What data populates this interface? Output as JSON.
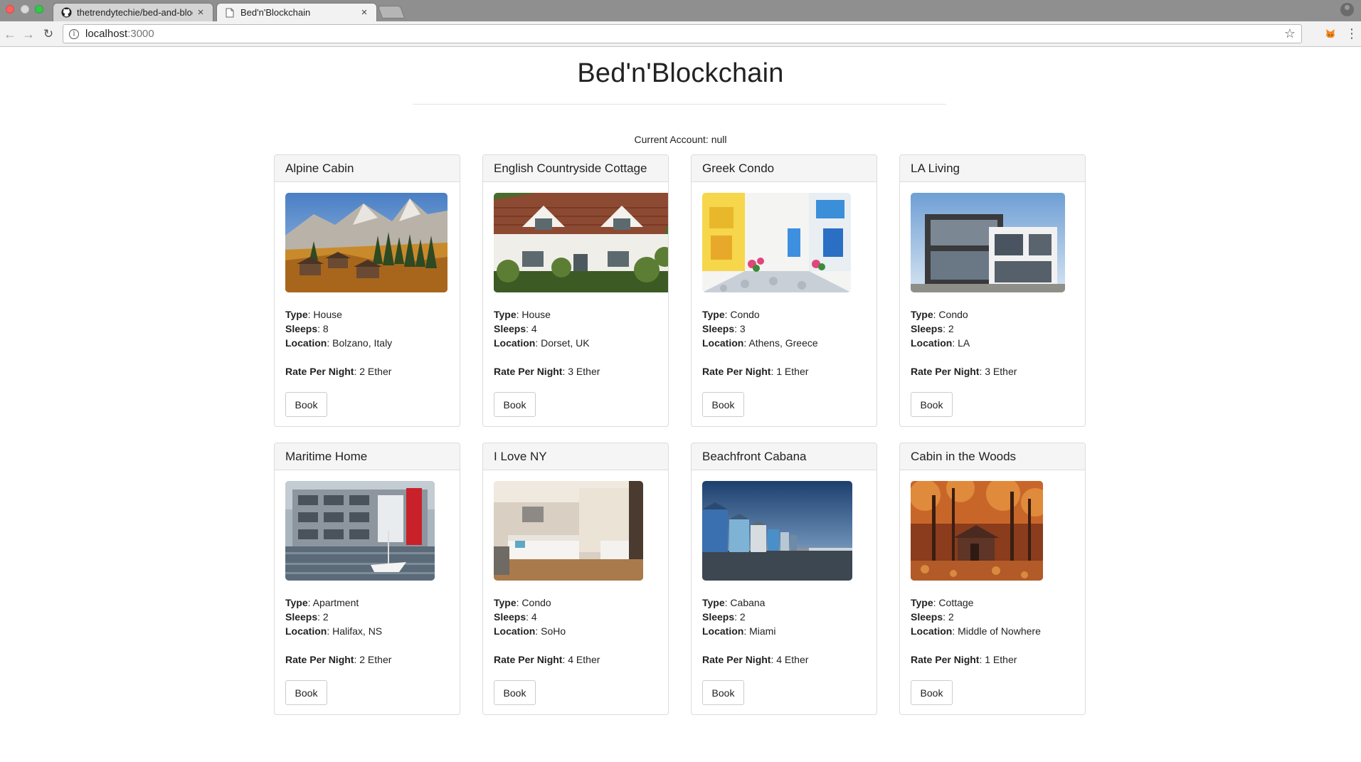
{
  "browser": {
    "tabs": [
      {
        "title": "thetrendytechie/bed-and-bloc",
        "icon": "github-icon",
        "active": false
      },
      {
        "title": "Bed'n'Blockchain",
        "icon": "page-icon",
        "active": true
      }
    ],
    "url_host": "localhost",
    "url_port": ":3000"
  },
  "page": {
    "title": "Bed'n'Blockchain",
    "account_label": "Current Account:",
    "account_value": "null"
  },
  "labels": {
    "type": "Type",
    "sleeps": "Sleeps",
    "location": "Location",
    "rate": "Rate Per Night",
    "book": "Book"
  },
  "listings": [
    {
      "name": "Alpine Cabin",
      "type": "House",
      "sleeps": "8",
      "location": "Bolzano, Italy",
      "rate": "2 Ether",
      "photo": "alpine-cabin-photo"
    },
    {
      "name": "English Countryside Cottage",
      "type": "House",
      "sleeps": "4",
      "location": "Dorset, UK",
      "rate": "3 Ether",
      "photo": "english-cottage-photo"
    },
    {
      "name": "Greek Condo",
      "type": "Condo",
      "sleeps": "3",
      "location": "Athens, Greece",
      "rate": "1 Ether",
      "photo": "greek-street-photo"
    },
    {
      "name": "LA Living",
      "type": "Condo",
      "sleeps": "2",
      "location": "LA",
      "rate": "3 Ether",
      "photo": "modern-house-photo"
    },
    {
      "name": "Maritime Home",
      "type": "Apartment",
      "sleeps": "2",
      "location": "Halifax, NS",
      "rate": "2 Ether",
      "photo": "waterfront-apartments-photo"
    },
    {
      "name": "I Love NY",
      "type": "Condo",
      "sleeps": "4",
      "location": "SoHo",
      "rate": "4 Ether",
      "photo": "hotel-room-photo"
    },
    {
      "name": "Beachfront Cabana",
      "type": "Cabana",
      "sleeps": "2",
      "location": "Miami",
      "rate": "4 Ether",
      "photo": "beach-huts-photo"
    },
    {
      "name": "Cabin in the Woods",
      "type": "Cottage",
      "sleeps": "2",
      "location": "Middle of Nowhere",
      "rate": "1 Ether",
      "photo": "forest-cabin-photo"
    }
  ]
}
